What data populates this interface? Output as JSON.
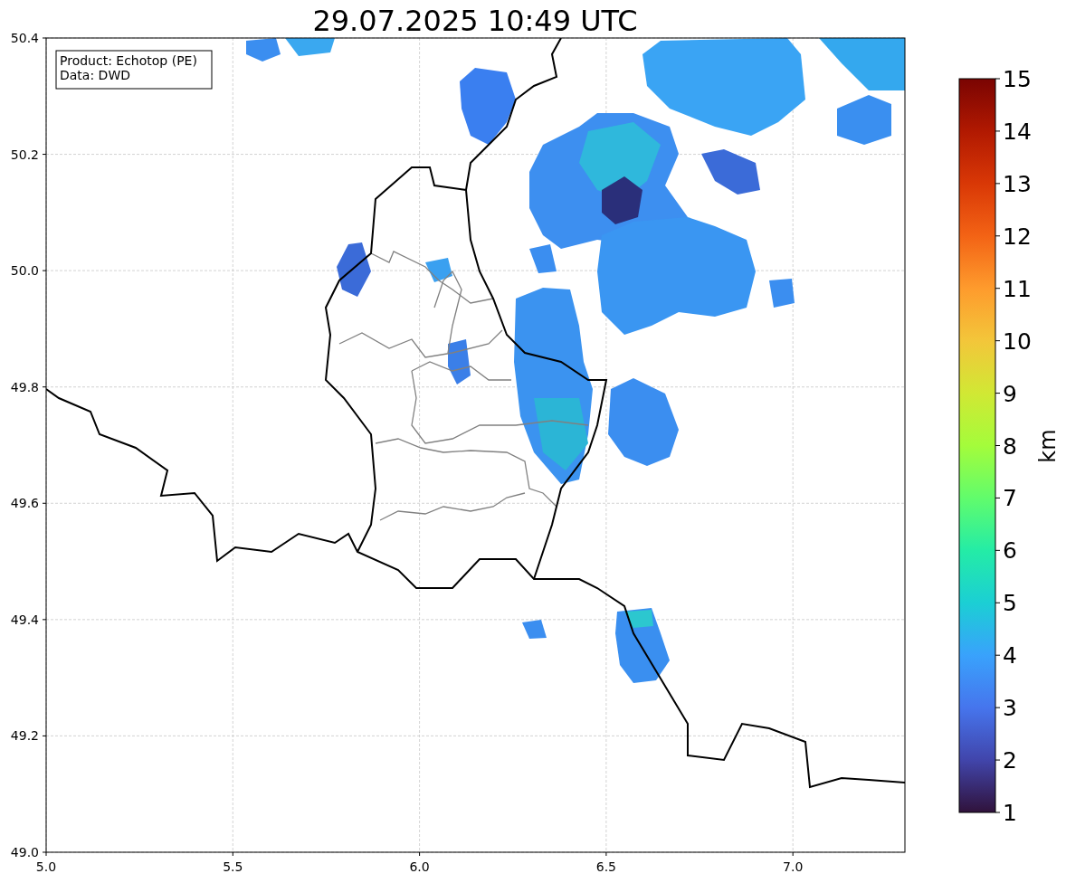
{
  "title": "29.07.2025 10:49 UTC",
  "map": {
    "info_box": [
      "Product: Echotop (PE)",
      "Data: DWD"
    ],
    "xticks": [
      "5.0",
      "5.5",
      "6.0",
      "6.5",
      "7.0"
    ],
    "yticks": [
      "50.4",
      "50.2",
      "50.0",
      "49.8",
      "49.6",
      "49.4",
      "49.2",
      "49.0"
    ]
  },
  "colorbar": {
    "label": "km",
    "ticks": [
      "15",
      "14",
      "13",
      "12",
      "11",
      "10",
      "9",
      "8",
      "7",
      "6",
      "5",
      "4",
      "3",
      "2",
      "1"
    ]
  }
}
